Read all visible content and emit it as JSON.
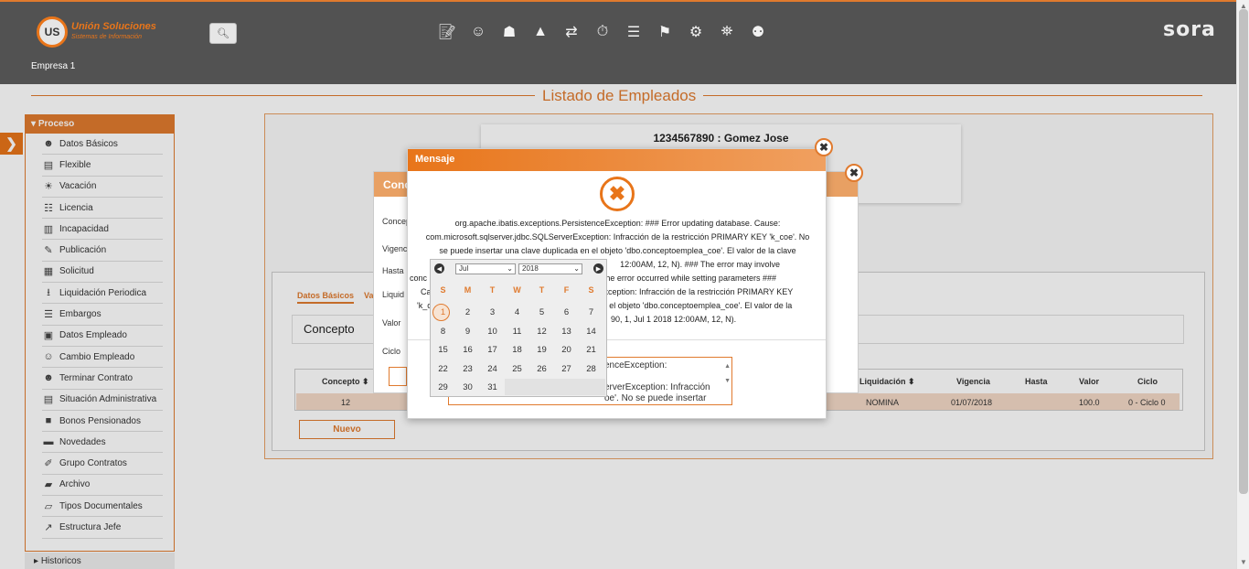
{
  "header": {
    "brand_abbr": "US",
    "brand_name": "Unión Soluciones",
    "brand_sub": "Sistemas de Información",
    "product": "sora",
    "company": "Empresa 1",
    "top_icons": [
      "document-edit-icon",
      "person-money-icon",
      "gift-icon",
      "org-chart-icon",
      "people-transfer-icon",
      "stopwatch-icon",
      "report-icon",
      "signpost-icon",
      "gears-icon",
      "car-location-icon",
      "group-icon"
    ]
  },
  "page_title": "Listado de Empleados",
  "sidebar": {
    "section": "Proceso",
    "items": [
      {
        "label": "Datos Básicos",
        "icon": "person-icon"
      },
      {
        "label": "Flexible",
        "icon": "money-icon"
      },
      {
        "label": "Vacación",
        "icon": "beach-icon"
      },
      {
        "label": "Licencia",
        "icon": "list-icon"
      },
      {
        "label": "Incapacidad",
        "icon": "book-icon"
      },
      {
        "label": "Publicación",
        "icon": "pen-icon"
      },
      {
        "label": "Solicitud",
        "icon": "form-icon"
      },
      {
        "label": "Liquidación Periodica",
        "icon": "download-icon"
      },
      {
        "label": "Embargos",
        "icon": "lines-icon"
      },
      {
        "label": "Datos Empleado",
        "icon": "id-card-icon"
      },
      {
        "label": "Cambio Empleado",
        "icon": "person-change-icon"
      },
      {
        "label": "Terminar Contrato",
        "icon": "person-stop-icon"
      },
      {
        "label": "Situación Administrativa",
        "icon": "file-icon"
      },
      {
        "label": "Bonos Pensionados",
        "icon": "notebook-icon"
      },
      {
        "label": "Novedades",
        "icon": "chat-icon"
      },
      {
        "label": "Grupo Contratos",
        "icon": "paperclip-icon"
      },
      {
        "label": "Archivo",
        "icon": "folder-icon"
      },
      {
        "label": "Tipos Documentales",
        "icon": "folder-open-icon"
      },
      {
        "label": "Estructura Jefe",
        "icon": "hierarchy-icon"
      }
    ],
    "historicos": "Historicos"
  },
  "employee": {
    "title": "1234567890 : Gomez Jose"
  },
  "tabs": [
    "Datos Básicos",
    "Va"
  ],
  "concepto_title": "Concepto",
  "table": {
    "headers": [
      "Concepto",
      "Liquidación",
      "Vigencia",
      "Hasta",
      "Valor",
      "Ciclo"
    ],
    "row": {
      "concepto": "12",
      "liquidacion": "NOMINA",
      "vigencia": "01/07/2018",
      "hasta": "",
      "valor": "100.0",
      "ciclo": "0 - Ciclo 0"
    }
  },
  "nuevo_label": "Nuevo",
  "back_dialog": {
    "title": "Conc",
    "fields": [
      "Concep",
      "Vigenc",
      "Hasta",
      "Liquid",
      "Valor",
      "Ciclo"
    ]
  },
  "message": {
    "title": "Mensaje",
    "lines": [
      "org.apache.ibatis.exceptions.PersistenceException: ### Error updating database. Cause:",
      "com.microsoft.sqlserver.jdbc.SQLServerException: Infracción de la restricción PRIMARY KEY 'k_coe'. No",
      "se puede insertar una clave duplicada en el objeto 'dbo.conceptoemplea_coe'. El valor de la clave",
      "12:00AM, 12, N). ### The error may involve",
      "ne ### The error occurred while setting parameters ###",
      "Exception: Infracción de la restricción PRIMARY KEY",
      "en el objeto 'dbo.conceptoemplea_coe'. El valor de la",
      "90, 1, Jul 1 2018 12:00AM, 12, N)."
    ],
    "line_prefixes": [
      "conc",
      "Ca",
      "'k_c"
    ],
    "area_lines": [
      "enceException:",
      ":",
      "erverException: Infracción",
      "oe'. No se puede insertar"
    ]
  },
  "calendar": {
    "month": "Jul",
    "year": "2018",
    "dow": [
      "S",
      "M",
      "T",
      "W",
      "T",
      "F",
      "S"
    ],
    "weeks": [
      [
        "1",
        "2",
        "3",
        "4",
        "5",
        "6",
        "7"
      ],
      [
        "8",
        "9",
        "10",
        "11",
        "12",
        "13",
        "14"
      ],
      [
        "15",
        "16",
        "17",
        "18",
        "19",
        "20",
        "21"
      ],
      [
        "22",
        "23",
        "24",
        "25",
        "26",
        "27",
        "28"
      ],
      [
        "29",
        "30",
        "31",
        "",
        "",
        "",
        ""
      ]
    ],
    "today": "1"
  },
  "colors": {
    "accent": "#e07a2e",
    "topbar": "#525252"
  }
}
